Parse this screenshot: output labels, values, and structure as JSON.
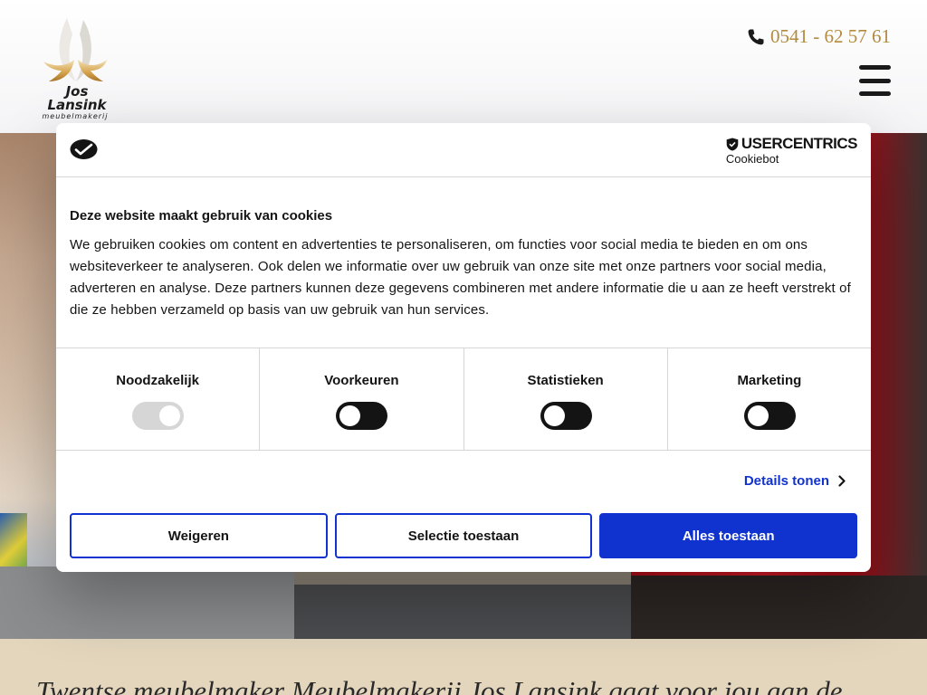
{
  "header": {
    "logo": {
      "name": "Jos Lansink",
      "subtitle": "meubelmakerij"
    },
    "phone": "0541 - 62 57 61",
    "phone_icon": "phone-icon",
    "menu_icon": "hamburger-icon",
    "phone_color": "#b38a3e"
  },
  "tagline": "Twentse meubelmaker Meubelmakerij Jos Lansink gaat voor jou aan de",
  "cookie_dialog": {
    "brand": {
      "name": "USERCENTRICS",
      "product": "Cookiebot"
    },
    "title": "Deze website maakt gebruik van cookies",
    "text": "We gebruiken cookies om content en advertenties te personaliseren, om functies voor social media te bieden en om ons websiteverkeer te analyseren. Ook delen we informatie over uw gebruik van onze site met onze partners voor social media, adverteren en analyse. Deze partners kunnen deze gegevens combineren met andere informatie die u aan ze heeft verstrekt of die ze hebben verzameld op basis van uw gebruik van hun services.",
    "categories": [
      {
        "label": "Noodzakelijk",
        "enabled": true,
        "locked": true
      },
      {
        "label": "Voorkeuren",
        "enabled": false,
        "locked": false
      },
      {
        "label": "Statistieken",
        "enabled": false,
        "locked": false
      },
      {
        "label": "Marketing",
        "enabled": false,
        "locked": false
      }
    ],
    "details_link": "Details tonen",
    "buttons": {
      "reject": "Weigeren",
      "allow_selection": "Selectie toestaan",
      "allow_all": "Alles toestaan"
    },
    "accent_color": "#1032cf"
  }
}
